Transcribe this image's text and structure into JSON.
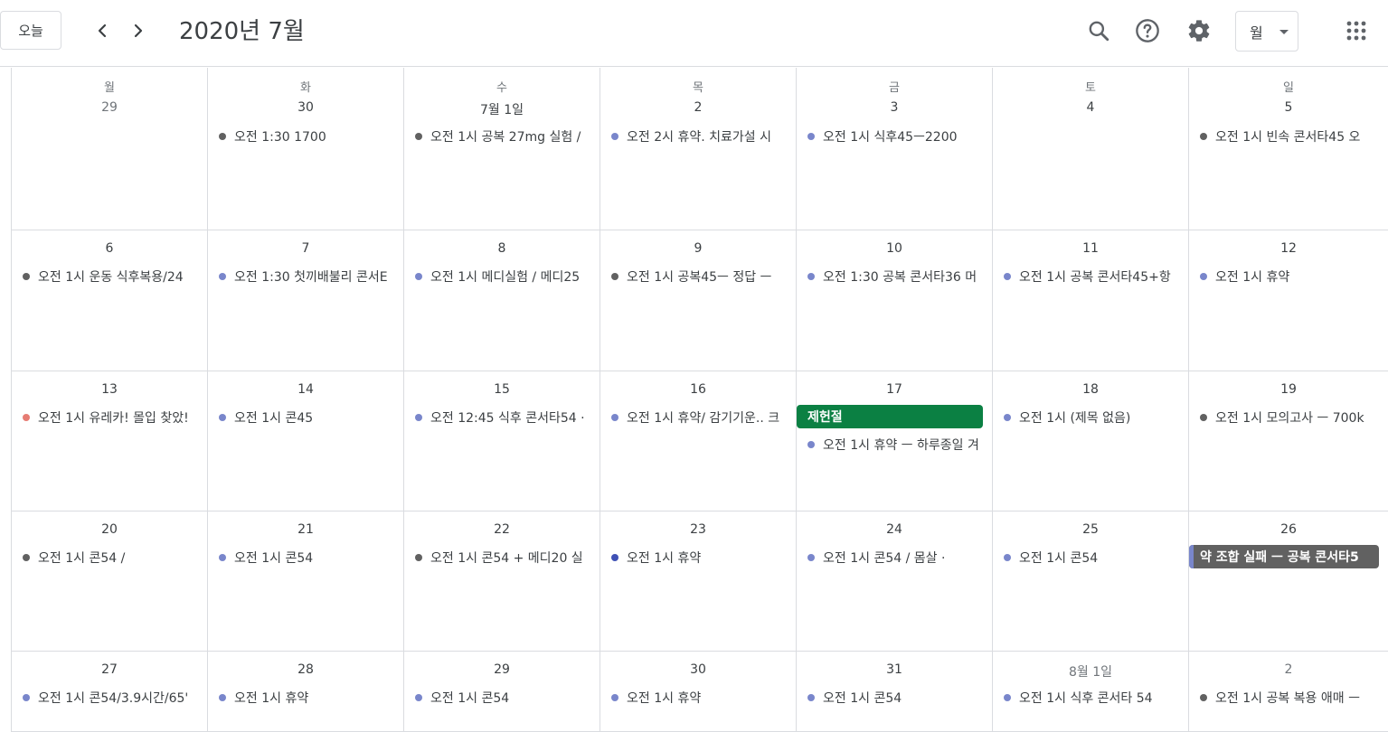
{
  "header": {
    "today_label": "오늘",
    "title": "2020년 7월",
    "view_label": "월",
    "icons": {
      "prev": "chevron-left-icon",
      "next": "chevron-right-icon",
      "search": "search-icon",
      "help": "help-icon",
      "settings": "gear-icon",
      "apps": "apps-grid-icon"
    }
  },
  "colors": {
    "gray": "#616161",
    "lavender": "#7986cb",
    "red": "#e67c73",
    "blueberry": "#3f51b5",
    "basil": "#0b8043",
    "graphite": "#616161"
  },
  "weekdays": [
    "월",
    "화",
    "수",
    "목",
    "금",
    "토",
    "일"
  ],
  "weeks": [
    {
      "days": [
        {
          "date": "29",
          "other": true,
          "events": []
        },
        {
          "date": "30",
          "events": [
            {
              "text": "오전 1:30 1700",
              "color": "#616161"
            }
          ]
        },
        {
          "date": "7월 1일",
          "events": [
            {
              "text": "오전 1시 공복 27mg 실험 /",
              "color": "#616161"
            }
          ]
        },
        {
          "date": "2",
          "events": [
            {
              "text": "오전 2시 휴약. 치료가설 시",
              "color": "#7986cb"
            }
          ]
        },
        {
          "date": "3",
          "events": [
            {
              "text": "오전 1시 식후45ㅡ2200",
              "color": "#7986cb"
            }
          ]
        },
        {
          "date": "4",
          "events": []
        },
        {
          "date": "5",
          "events": [
            {
              "text": "오전 1시 빈속 콘서타45 오",
              "color": "#616161"
            }
          ]
        }
      ]
    },
    {
      "days": [
        {
          "date": "6",
          "events": [
            {
              "text": "오전 1시 운동 식후복용/24",
              "color": "#616161"
            }
          ]
        },
        {
          "date": "7",
          "events": [
            {
              "text": "오전 1:30 첫끼배불리 콘서E",
              "color": "#7986cb"
            }
          ]
        },
        {
          "date": "8",
          "events": [
            {
              "text": "오전 1시 메디실험 / 메디25",
              "color": "#7986cb"
            }
          ]
        },
        {
          "date": "9",
          "events": [
            {
              "text": "오전 1시 공복45ㅡ 정답 ㅡ",
              "color": "#616161"
            }
          ]
        },
        {
          "date": "10",
          "events": [
            {
              "text": "오전 1:30 공복 콘서타36 머",
              "color": "#7986cb"
            }
          ]
        },
        {
          "date": "11",
          "events": [
            {
              "text": "오전 1시 공복 콘서타45+항",
              "color": "#7986cb"
            }
          ]
        },
        {
          "date": "12",
          "events": [
            {
              "text": "오전 1시 휴약",
              "color": "#7986cb"
            }
          ]
        }
      ]
    },
    {
      "days": [
        {
          "date": "13",
          "events": [
            {
              "text": "오전 1시 유레카! 몰입 찾았!",
              "color": "#e67c73"
            }
          ]
        },
        {
          "date": "14",
          "events": [
            {
              "text": "오전 1시 콘45",
              "color": "#7986cb"
            }
          ]
        },
        {
          "date": "15",
          "events": [
            {
              "text": "오전 12:45 식후 콘서타54 ·",
              "color": "#7986cb"
            }
          ]
        },
        {
          "date": "16",
          "events": [
            {
              "text": "오전 1시 휴약/ 감기기운.. 크",
              "color": "#7986cb"
            }
          ]
        },
        {
          "date": "17",
          "allday": {
            "text": "제헌절",
            "color": "#0b8043"
          },
          "events": [
            {
              "text": "오전 1시 휴약 ㅡ 하루종일 겨",
              "color": "#7986cb"
            }
          ]
        },
        {
          "date": "18",
          "events": [
            {
              "text": "오전 1시 (제목 없음)",
              "color": "#7986cb"
            }
          ]
        },
        {
          "date": "19",
          "events": [
            {
              "text": "오전 1시 모의고사 ㅡ 700k",
              "color": "#616161"
            }
          ]
        }
      ]
    },
    {
      "days": [
        {
          "date": "20",
          "events": [
            {
              "text": "오전 1시 콘54 /",
              "color": "#616161"
            }
          ]
        },
        {
          "date": "21",
          "events": [
            {
              "text": "오전 1시 콘54",
              "color": "#7986cb"
            }
          ]
        },
        {
          "date": "22",
          "events": [
            {
              "text": "오전 1시 콘54 + 메디20 실",
              "color": "#616161"
            }
          ]
        },
        {
          "date": "23",
          "events": [
            {
              "text": "오전 1시 휴약",
              "color": "#3f51b5"
            }
          ]
        },
        {
          "date": "24",
          "events": [
            {
              "text": "오전 1시 콘54 / 몸살 ·",
              "color": "#7986cb"
            }
          ]
        },
        {
          "date": "25",
          "events": [
            {
              "text": "오전 1시 콘54",
              "color": "#7986cb"
            }
          ]
        },
        {
          "date": "26",
          "allday": {
            "text": "약 조합 실패 ㅡ 공복 콘서타5",
            "color": "#616161",
            "bar": "#7986cb"
          },
          "events": []
        }
      ]
    },
    {
      "days": [
        {
          "date": "27",
          "events": [
            {
              "text": "오전 1시 콘54/3.9시간/65'",
              "color": "#7986cb"
            }
          ]
        },
        {
          "date": "28",
          "events": [
            {
              "text": "오전 1시 휴약",
              "color": "#7986cb"
            }
          ]
        },
        {
          "date": "29",
          "events": [
            {
              "text": "오전 1시 콘54",
              "color": "#7986cb"
            }
          ]
        },
        {
          "date": "30",
          "events": [
            {
              "text": "오전 1시 휴약",
              "color": "#7986cb"
            }
          ]
        },
        {
          "date": "31",
          "events": [
            {
              "text": "오전 1시 콘54",
              "color": "#7986cb"
            }
          ]
        },
        {
          "date": "8월 1일",
          "other": true,
          "events": [
            {
              "text": "오전 1시 식후 콘서타 54",
              "color": "#7986cb"
            }
          ]
        },
        {
          "date": "2",
          "other": true,
          "events": [
            {
              "text": "오전 1시 공복 복용 애매 ㅡ",
              "color": "#616161"
            }
          ]
        }
      ]
    }
  ]
}
